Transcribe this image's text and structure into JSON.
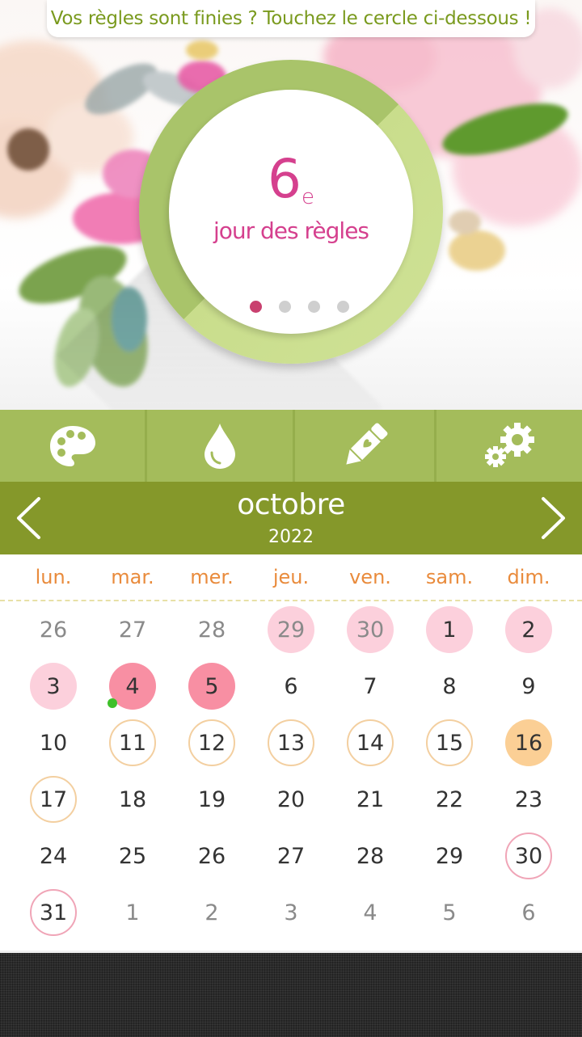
{
  "banner": {
    "text": "Vos règles sont finies ? Touchez le cercle ci-dessous !"
  },
  "cycle": {
    "day_number": "6",
    "day_suffix": "e",
    "day_label": "jour des règles",
    "pager": {
      "pages": 4,
      "active": 1
    }
  },
  "toolbar": {
    "items": [
      {
        "icon": "palette-icon"
      },
      {
        "icon": "drop-icon"
      },
      {
        "icon": "pencil-heart-icon"
      },
      {
        "icon": "gears-icon"
      }
    ]
  },
  "calendar": {
    "month": "octobre",
    "year": "2022",
    "prev_icon": "chevron-left-icon",
    "next_icon": "chevron-right-icon",
    "weekdays": [
      "lun.",
      "mar.",
      "mer.",
      "jeu.",
      "ven.",
      "sam.",
      "dim."
    ],
    "days": [
      {
        "label": "26",
        "other": true,
        "mark": ""
      },
      {
        "label": "27",
        "other": true,
        "mark": ""
      },
      {
        "label": "28",
        "other": true,
        "mark": ""
      },
      {
        "label": "29",
        "other": true,
        "mark": "past"
      },
      {
        "label": "30",
        "other": true,
        "mark": "past"
      },
      {
        "label": "1",
        "other": false,
        "mark": "past"
      },
      {
        "label": "2",
        "other": false,
        "mark": "past"
      },
      {
        "label": "3",
        "other": false,
        "mark": "past"
      },
      {
        "label": "4",
        "other": false,
        "mark": "period",
        "note": true
      },
      {
        "label": "5",
        "other": false,
        "mark": "period"
      },
      {
        "label": "6",
        "other": false,
        "mark": ""
      },
      {
        "label": "7",
        "other": false,
        "mark": ""
      },
      {
        "label": "8",
        "other": false,
        "mark": ""
      },
      {
        "label": "9",
        "other": false,
        "mark": ""
      },
      {
        "label": "10",
        "other": false,
        "mark": ""
      },
      {
        "label": "11",
        "other": false,
        "mark": "fertile"
      },
      {
        "label": "12",
        "other": false,
        "mark": "fertile"
      },
      {
        "label": "13",
        "other": false,
        "mark": "fertile"
      },
      {
        "label": "14",
        "other": false,
        "mark": "fertile"
      },
      {
        "label": "15",
        "other": false,
        "mark": "fertile"
      },
      {
        "label": "16",
        "other": false,
        "mark": "ovu"
      },
      {
        "label": "17",
        "other": false,
        "mark": "fertile"
      },
      {
        "label": "18",
        "other": false,
        "mark": ""
      },
      {
        "label": "19",
        "other": false,
        "mark": ""
      },
      {
        "label": "20",
        "other": false,
        "mark": ""
      },
      {
        "label": "21",
        "other": false,
        "mark": ""
      },
      {
        "label": "22",
        "other": false,
        "mark": ""
      },
      {
        "label": "23",
        "other": false,
        "mark": ""
      },
      {
        "label": "24",
        "other": false,
        "mark": ""
      },
      {
        "label": "25",
        "other": false,
        "mark": ""
      },
      {
        "label": "26",
        "other": false,
        "mark": ""
      },
      {
        "label": "27",
        "other": false,
        "mark": ""
      },
      {
        "label": "28",
        "other": false,
        "mark": ""
      },
      {
        "label": "29",
        "other": false,
        "mark": ""
      },
      {
        "label": "30",
        "other": false,
        "mark": "next"
      },
      {
        "label": "31",
        "other": false,
        "mark": "next"
      },
      {
        "label": "1",
        "other": true,
        "mark": ""
      },
      {
        "label": "2",
        "other": true,
        "mark": ""
      },
      {
        "label": "3",
        "other": true,
        "mark": ""
      },
      {
        "label": "4",
        "other": true,
        "mark": ""
      },
      {
        "label": "5",
        "other": true,
        "mark": ""
      },
      {
        "label": "6",
        "other": true,
        "mark": ""
      }
    ]
  },
  "colors": {
    "accent_green": "#85982a",
    "toolbar_green": "#a4bc5b",
    "pink_text": "#d5408e",
    "weekday_orange": "#e98b3c"
  }
}
